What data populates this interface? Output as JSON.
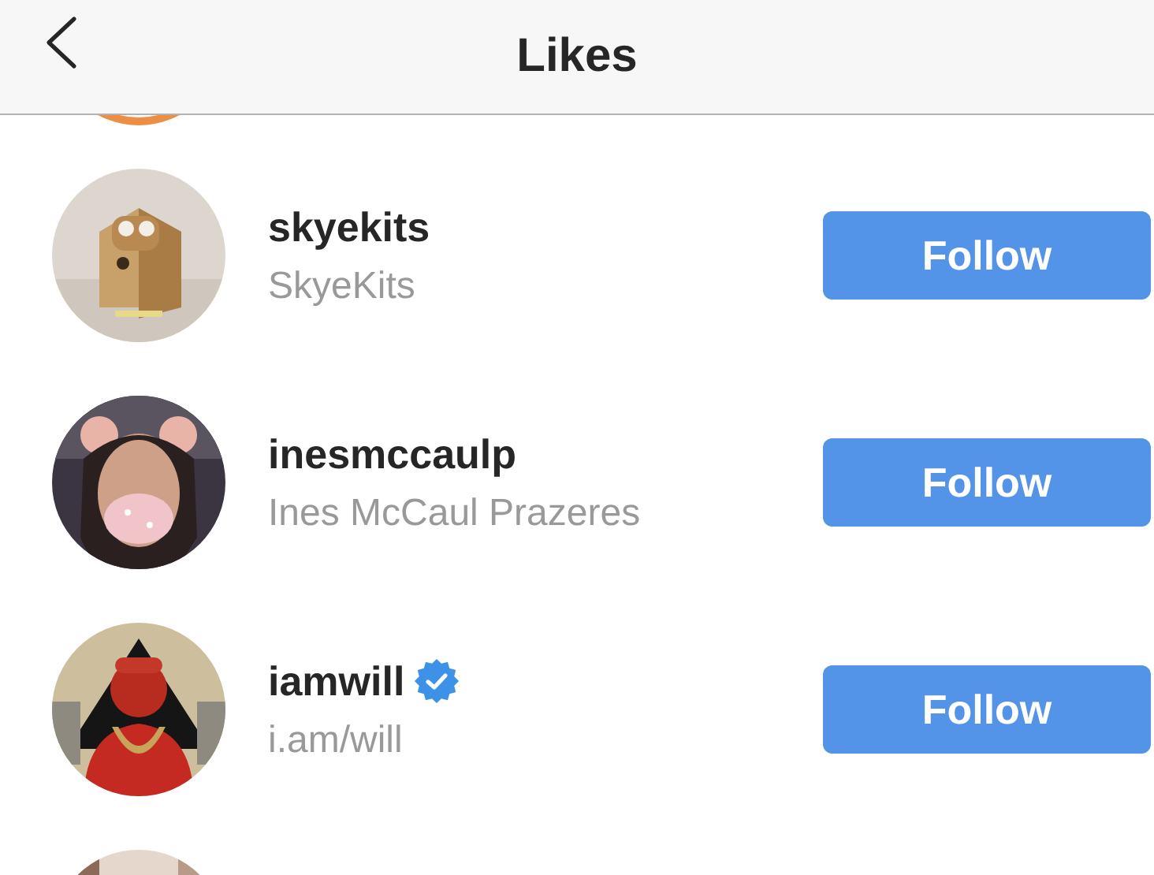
{
  "header": {
    "title": "Likes"
  },
  "users": [
    {
      "username": "skyekits",
      "full_name": "SkyeKits",
      "verified": false,
      "button": "Follow"
    },
    {
      "username": "inesmccaulp",
      "full_name": "Ines McCaul Prazeres",
      "verified": false,
      "button": "Follow"
    },
    {
      "username": "iamwill",
      "full_name": "i.am/will",
      "verified": true,
      "button": "Follow"
    }
  ]
}
